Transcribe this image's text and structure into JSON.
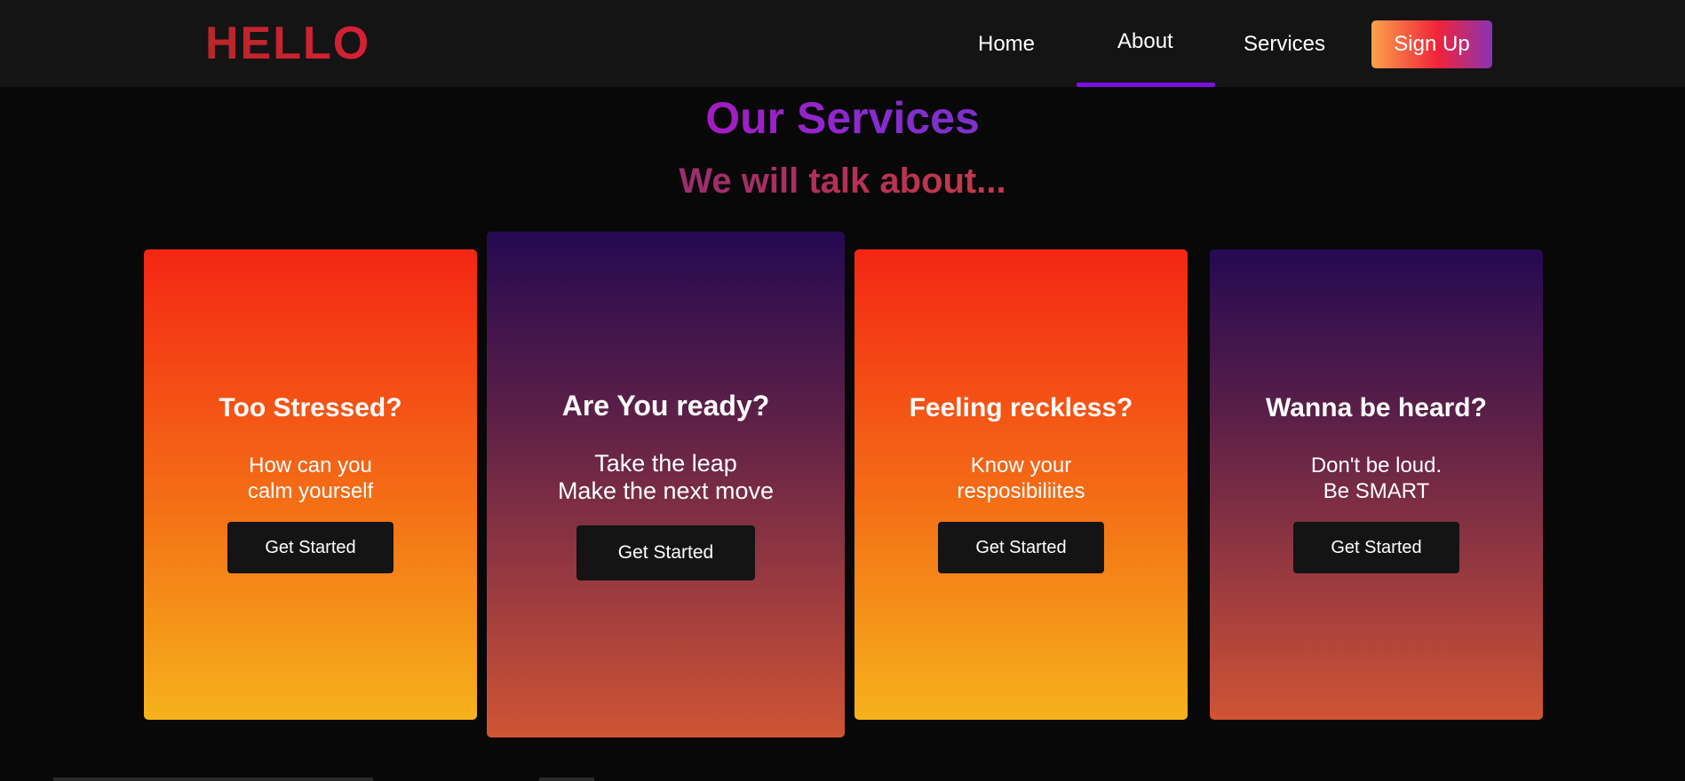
{
  "header": {
    "logo": "HELLO",
    "nav": [
      {
        "label": "Home"
      },
      {
        "label": "About",
        "active": true
      },
      {
        "label": "Services"
      }
    ],
    "signup_label": "Sign Up",
    "active_indicator_color": "#7a0fe0"
  },
  "section": {
    "title": "Our Services",
    "subtitle": "We will talk about..."
  },
  "cards": [
    {
      "title": "Too Stressed?",
      "lines": [
        "How can you",
        "calm yourself"
      ],
      "button": "Get Started",
      "theme": "warm"
    },
    {
      "title": "Are You ready?",
      "lines": [
        "Take the leap",
        "Make the next move"
      ],
      "button": "Get Started",
      "theme": "cool",
      "featured": true
    },
    {
      "title": "Feeling reckless?",
      "lines": [
        "Know your",
        "resposibiliites"
      ],
      "button": "Get Started",
      "theme": "warm"
    },
    {
      "title": "Wanna be heard?",
      "lines": [
        "Don't be loud.",
        "Be SMART"
      ],
      "button": "Get Started",
      "theme": "cool"
    }
  ],
  "colors": {
    "background": "#080808",
    "navbar": "#141414",
    "logo": "#d81f35",
    "warm_top": "#f42614",
    "warm_bottom": "#f6b21c",
    "cool_top": "#250952",
    "cool_bottom": "#cf5434",
    "button": "#141414"
  }
}
